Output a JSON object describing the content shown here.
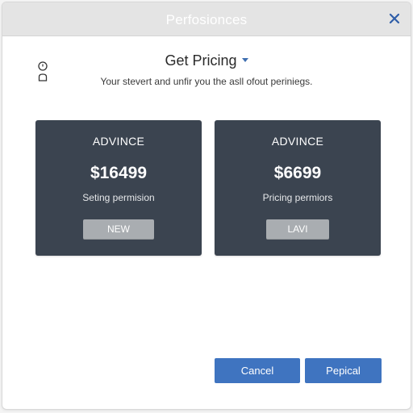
{
  "dialog": {
    "title": "Perfosionces"
  },
  "header": {
    "heading": "Get Pricing",
    "subtitle": "Your stevert and unfir you the asll ofout periniegs."
  },
  "cards": [
    {
      "tier": "ADVINCE",
      "price": "$16499",
      "description": "Seting permision",
      "button_label": "NEW"
    },
    {
      "tier": "ADVINCE",
      "price": "$6699",
      "description": "Pricing permiors",
      "button_label": "LAVI"
    }
  ],
  "footer": {
    "cancel_label": "Cancel",
    "primary_label": "Pepical"
  },
  "colors": {
    "titlebar": "#e4e4e4",
    "card_background": "#3b4450",
    "card_button": "#a9adb1",
    "accent_button": "#3f74c0",
    "close_icon": "#2f5ea8"
  },
  "icons": {
    "close": "close-icon",
    "lock": "lock-icon",
    "dropdown": "chevron-down-icon"
  }
}
